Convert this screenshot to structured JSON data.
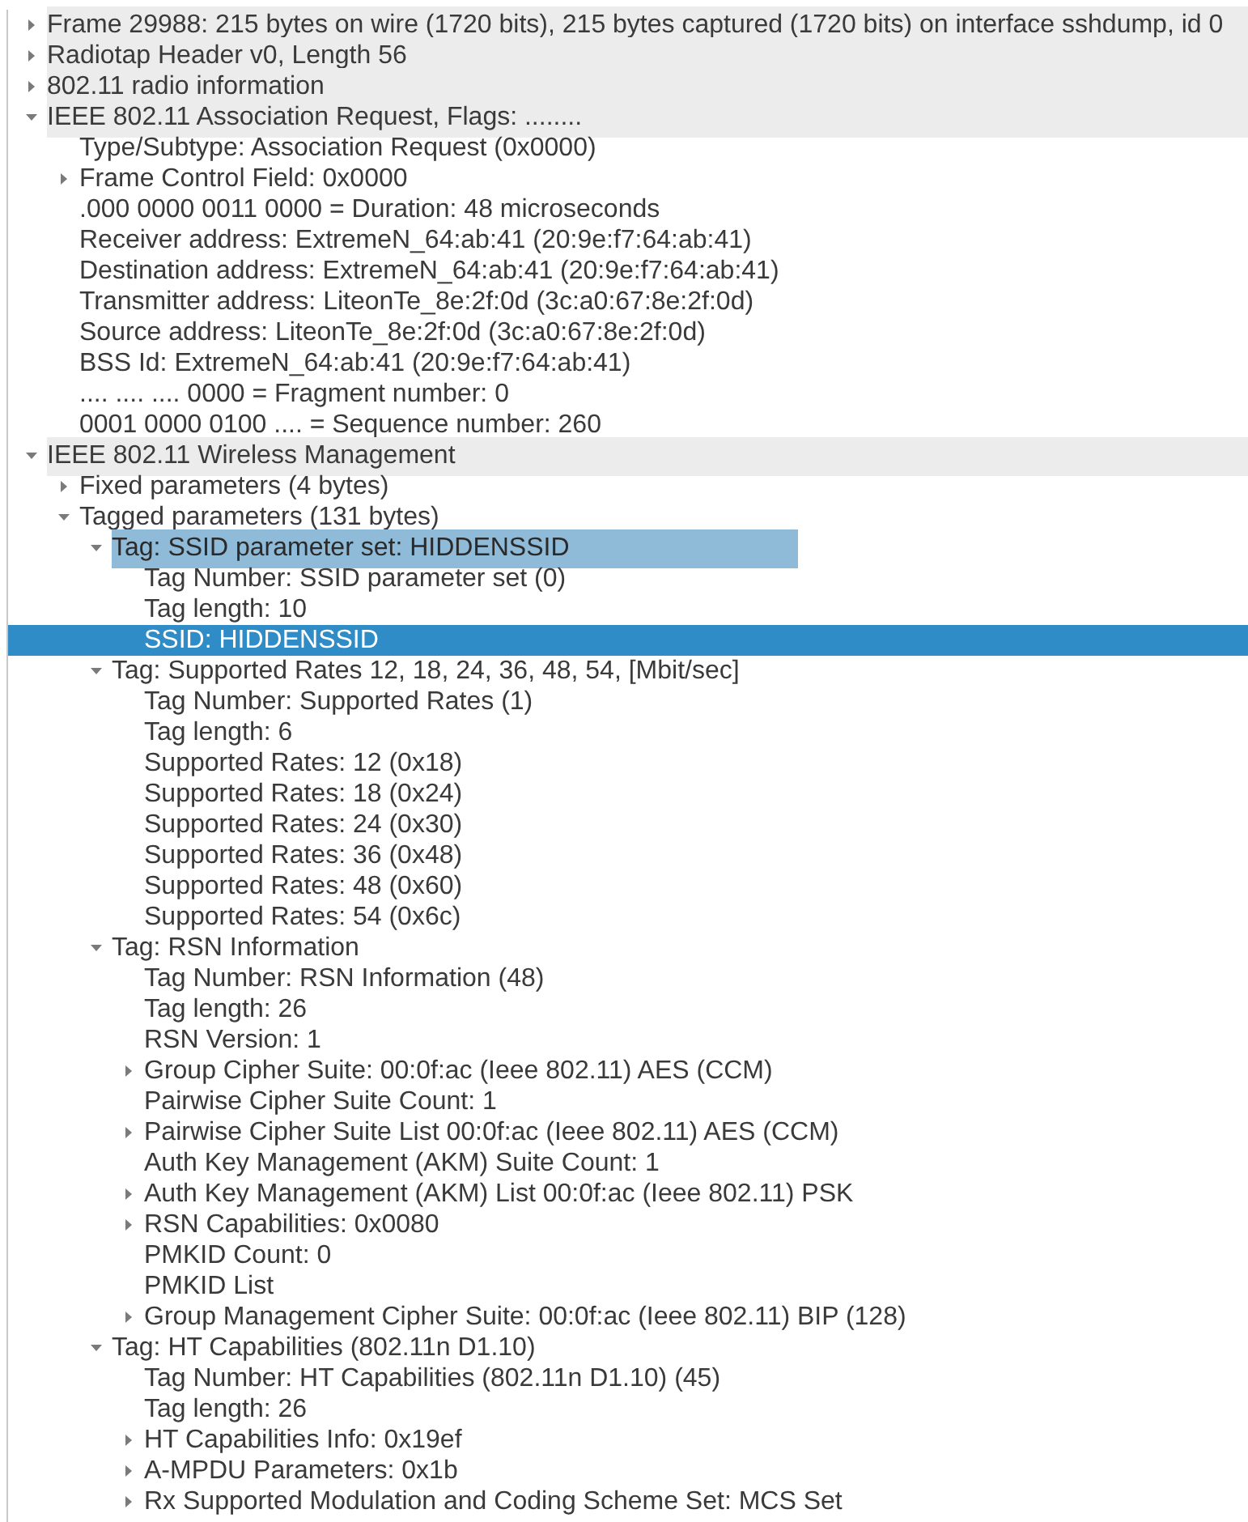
{
  "tree": [
    {
      "label": "Frame 29988: 215 bytes on wire (1720 bits), 215 bytes captured (1720 bits) on interface sshdump, id 0",
      "expanded": false,
      "selected": false
    },
    {
      "label": "Radiotap Header v0, Length 56",
      "expanded": false,
      "selected": false
    },
    {
      "label": "802.11 radio information",
      "expanded": false,
      "selected": false
    },
    {
      "label": "IEEE 802.11 Association Request, Flags: ........",
      "expanded": true,
      "selected": false,
      "children": [
        {
          "label": "Type/Subtype: Association Request (0x0000)",
          "selected": false
        },
        {
          "label": "Frame Control Field: 0x0000",
          "expanded": false,
          "selected": false
        },
        {
          "label": ".000 0000 0011 0000 = Duration: 48 microseconds",
          "selected": false
        },
        {
          "label": "Receiver address: ExtremeN_64:ab:41 (20:9e:f7:64:ab:41)",
          "selected": false
        },
        {
          "label": "Destination address: ExtremeN_64:ab:41 (20:9e:f7:64:ab:41)",
          "selected": false
        },
        {
          "label": "Transmitter address: LiteonTe_8e:2f:0d (3c:a0:67:8e:2f:0d)",
          "selected": false
        },
        {
          "label": "Source address: LiteonTe_8e:2f:0d (3c:a0:67:8e:2f:0d)",
          "selected": false
        },
        {
          "label": "BSS Id: ExtremeN_64:ab:41 (20:9e:f7:64:ab:41)",
          "selected": false
        },
        {
          "label": ".... .... .... 0000 = Fragment number: 0",
          "selected": false
        },
        {
          "label": "0001 0000 0100 .... = Sequence number: 260",
          "selected": false
        }
      ]
    },
    {
      "label": "IEEE 802.11 Wireless Management",
      "expanded": true,
      "selected": false,
      "children": [
        {
          "label": "Fixed parameters (4 bytes)",
          "expanded": false,
          "selected": false
        },
        {
          "label": "Tagged parameters (131 bytes)",
          "expanded": true,
          "selected": false,
          "children": [
            {
              "label": "Tag: SSID parameter set: HIDDENSSID",
              "expanded": true,
              "selected": false,
              "children": [
                {
                  "label": "Tag Number: SSID parameter set (0)",
                  "selected": false
                },
                {
                  "label": "Tag length: 10",
                  "selected": false
                },
                {
                  "label": "SSID: HIDDENSSID",
                  "selected": true
                }
              ]
            },
            {
              "label": "Tag: Supported Rates 12, 18, 24, 36, 48, 54, [Mbit/sec]",
              "expanded": true,
              "selected": false,
              "children": [
                {
                  "label": "Tag Number: Supported Rates (1)",
                  "selected": false
                },
                {
                  "label": "Tag length: 6",
                  "selected": false
                },
                {
                  "label": "Supported Rates: 12 (0x18)",
                  "selected": false
                },
                {
                  "label": "Supported Rates: 18 (0x24)",
                  "selected": false
                },
                {
                  "label": "Supported Rates: 24 (0x30)",
                  "selected": false
                },
                {
                  "label": "Supported Rates: 36 (0x48)",
                  "selected": false
                },
                {
                  "label": "Supported Rates: 48 (0x60)",
                  "selected": false
                },
                {
                  "label": "Supported Rates: 54 (0x6c)",
                  "selected": false
                }
              ]
            },
            {
              "label": "Tag: RSN Information",
              "expanded": true,
              "selected": false,
              "children": [
                {
                  "label": "Tag Number: RSN Information (48)",
                  "selected": false
                },
                {
                  "label": "Tag length: 26",
                  "selected": false
                },
                {
                  "label": "RSN Version: 1",
                  "selected": false
                },
                {
                  "label": "Group Cipher Suite: 00:0f:ac (Ieee 802.11) AES (CCM)",
                  "expanded": false,
                  "selected": false
                },
                {
                  "label": "Pairwise Cipher Suite Count: 1",
                  "selected": false
                },
                {
                  "label": "Pairwise Cipher Suite List 00:0f:ac (Ieee 802.11) AES (CCM)",
                  "expanded": false,
                  "selected": false
                },
                {
                  "label": "Auth Key Management (AKM) Suite Count: 1",
                  "selected": false
                },
                {
                  "label": "Auth Key Management (AKM) List 00:0f:ac (Ieee 802.11) PSK",
                  "expanded": false,
                  "selected": false
                },
                {
                  "label": "RSN Capabilities: 0x0080",
                  "expanded": false,
                  "selected": false
                },
                {
                  "label": "PMKID Count: 0",
                  "selected": false
                },
                {
                  "label": "PMKID List",
                  "selected": false
                },
                {
                  "label": "Group Management Cipher Suite: 00:0f:ac (Ieee 802.11) BIP (128)",
                  "expanded": false,
                  "selected": false
                }
              ]
            },
            {
              "label": "Tag: HT Capabilities (802.11n D1.10)",
              "expanded": true,
              "selected": false,
              "children": [
                {
                  "label": "Tag Number: HT Capabilities (802.11n D1.10) (45)",
                  "selected": false
                },
                {
                  "label": "Tag length: 26",
                  "selected": false
                },
                {
                  "label": "HT Capabilities Info: 0x19ef",
                  "expanded": false,
                  "selected": false
                },
                {
                  "label": "A-MPDU Parameters: 0x1b",
                  "expanded": false,
                  "selected": false
                },
                {
                  "label": "Rx Supported Modulation and Coding Scheme Set: MCS Set",
                  "expanded": false,
                  "selected": false
                }
              ]
            }
          ]
        }
      ]
    }
  ]
}
